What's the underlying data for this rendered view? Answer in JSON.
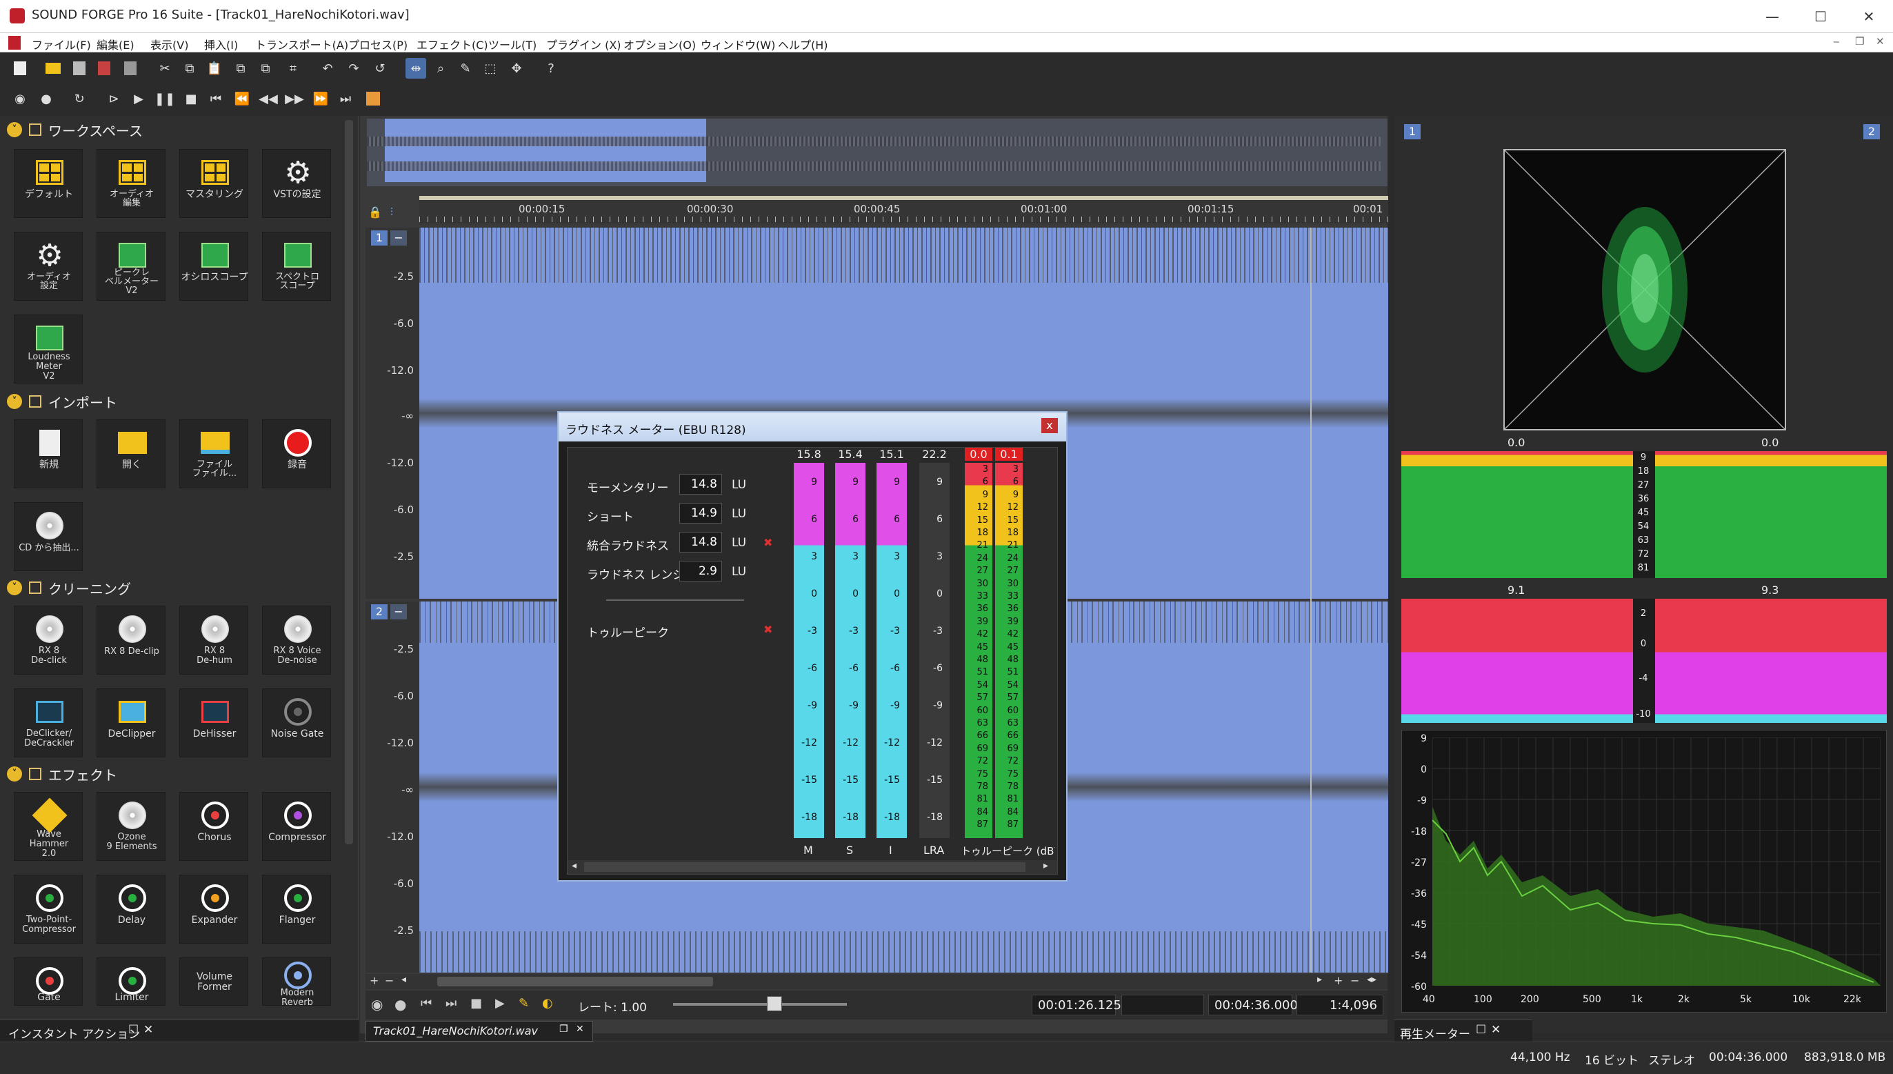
{
  "title_bar": {
    "app_title": "SOUND FORGE Pro 16 Suite - [Track01_HareNochiKotori.wav]",
    "minimize": "—",
    "maximize": "☐",
    "close": "✕"
  },
  "menu": [
    "ファイル(F)",
    "編集(E)",
    "表示(V)",
    "挿入(I)",
    "トランスポート(A)",
    "プロセス(P)",
    "エフェクト(C)",
    "ツール(T)",
    "プラグイン (X)",
    "オプション(O)",
    "ウィンドウ(W)",
    "ヘルプ(H)"
  ],
  "workspace": {
    "section_workspace": "ワークスペース",
    "workspace_tiles": [
      "デフォルト",
      "オーディオ\n編集",
      "マスタリング",
      "VSTの設定",
      "オーディオ\n設定",
      "ピークレ\nベルメーター\nV2",
      "オシロスコープ",
      "スペクトロ\nスコープ",
      "Loudness\nMeter\nV2"
    ],
    "section_import": "インポート",
    "import_tiles": [
      "新規",
      "開く",
      "ファイル\nファイル...",
      "録音",
      "CD から抽出..."
    ],
    "section_cleaning": "クリーニング",
    "cleaning_tiles": [
      "RX 8\nDe-click",
      "RX 8 De-clip",
      "RX 8\nDe-hum",
      "RX 8 Voice\nDe-noise",
      "DeClicker/\nDeCrackler",
      "DeClipper",
      "DeHisser",
      "Noise Gate"
    ],
    "section_effects": "エフェクト",
    "effect_tiles": [
      "Wave\nHammer\n2.0",
      "Ozone\n9 Elements",
      "Chorus",
      "Compressor",
      "Two-Point-\nCompressor",
      "Delay",
      "Expander",
      "Flanger",
      "Gate",
      "Limiter",
      "Volume\nFormer",
      "Modern\nReverb"
    ],
    "bottom_tab": "インスタント アクション"
  },
  "ruler": {
    "labels": [
      "00:00:15",
      "00:00:30",
      "00:00:45",
      "00:01:00",
      "00:01:15",
      "00:01"
    ]
  },
  "channel1": {
    "badge": "1",
    "labels": [
      "-2.5",
      "-6.0",
      "-12.0",
      "-∞",
      "-12.0",
      "-6.0",
      "-2.5"
    ]
  },
  "channel2": {
    "badge": "2",
    "labels": [
      "-2.5",
      "-6.0",
      "-12.0",
      "-∞",
      "-12.0",
      "-6.0",
      "-2.5"
    ]
  },
  "loudness": {
    "title": "ラウドネス メーター (EBU R128)",
    "close": "x",
    "rows": [
      {
        "label": "モーメンタリー",
        "value": "14.8",
        "unit": "LU"
      },
      {
        "label": "ショート",
        "value": "14.9",
        "unit": "LU"
      },
      {
        "label": "統合ラウドネス",
        "value": "14.8",
        "unit": "LU"
      },
      {
        "label": "ラウドネス レンジ",
        "value": "2.9",
        "unit": "LU"
      }
    ],
    "true_peak_label": "トゥルーピーク",
    "marker": "✖",
    "meter_tops": {
      "M": "15.8",
      "S": "15.4",
      "I": "15.1",
      "LRA": "22.2",
      "TP_L": "0.0",
      "TP_R": "0.1"
    },
    "meter_labels": {
      "M": "M",
      "S": "S",
      "I": "I",
      "LRA": "LRA",
      "TP": "トゥルーピーク (dBTP)"
    },
    "lu_ticks": [
      "9",
      "6",
      "3",
      "0",
      "-3",
      "-6",
      "-9",
      "-12",
      "-15",
      "-18"
    ],
    "tp_ticks": [
      "3",
      "6",
      "9",
      "12",
      "15",
      "18",
      "21",
      "24",
      "27",
      "30",
      "33",
      "36",
      "39",
      "42",
      "45",
      "48",
      "51",
      "54",
      "57",
      "60",
      "63",
      "66",
      "69",
      "72",
      "75",
      "78",
      "81",
      "84",
      "87"
    ]
  },
  "transport": {
    "rate_label": "レート: 1.00",
    "cursor": "00:01:26.125",
    "length": "00:04:36.000",
    "zoom": "1:4,096",
    "doc_tab": "Track01_HareNochiKotori.wav"
  },
  "right_panel": {
    "badge_left": "1",
    "badge_right": "2",
    "phase_left": "0.0",
    "phase_right": "0.0",
    "level_left": "9.1",
    "level_right": "9.3",
    "peak_ticks": [
      "9",
      "18",
      "27",
      "36",
      "45",
      "54",
      "63",
      "72",
      "81"
    ],
    "lr_ticks": [
      "2",
      "0",
      "-4",
      "-10"
    ],
    "spec_y": [
      "9",
      "0",
      "-9",
      "-18",
      "-27",
      "-36",
      "-45",
      "-54",
      "-60"
    ],
    "spec_x": [
      "40",
      "100",
      "200",
      "500",
      "1k",
      "2k",
      "5k",
      "10k",
      "22k"
    ],
    "bottom_tab": "再生メーター"
  },
  "status": {
    "samplerate": "44,100 Hz",
    "bits": "16 ビット",
    "channels": "ステレオ",
    "duration": "00:04:36.000",
    "size": "883,918.0 MB"
  },
  "colors": {
    "wave": "#7c97dc",
    "accent": "#4a6ea8",
    "meter_magenta": "#e050e8",
    "meter_cyan": "#58d8e8",
    "meter_green": "#2ab040",
    "meter_yellow": "#f2c21c",
    "meter_red": "#e83a4c"
  }
}
